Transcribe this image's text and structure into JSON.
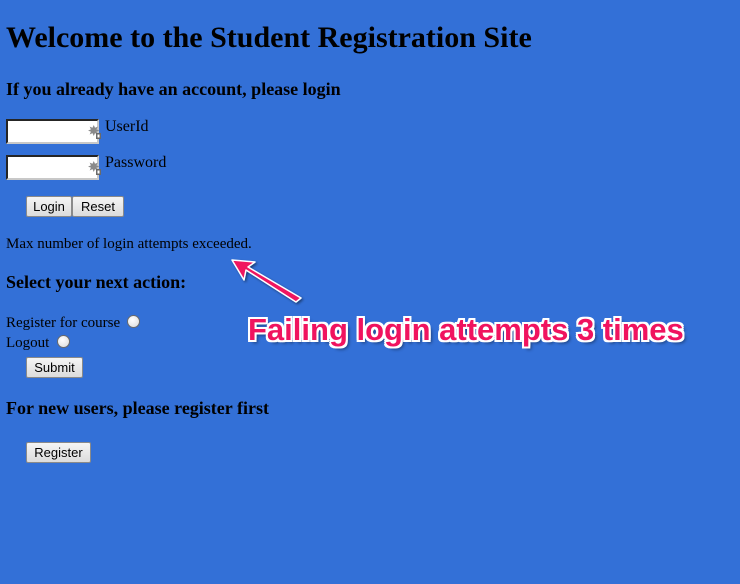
{
  "page": {
    "title": "Welcome to the Student Registration Site"
  },
  "login": {
    "heading": "If you already have an account, please login",
    "userid_label": "UserId",
    "userid_value": "",
    "password_label": "Password",
    "password_value": "",
    "login_button": "Login",
    "reset_button": "Reset",
    "status_message": "Max number of login attempts exceeded."
  },
  "actions": {
    "heading": "Select your next action:",
    "options": [
      {
        "label": "Register for course",
        "selected": false
      },
      {
        "label": "Logout",
        "selected": false
      }
    ],
    "submit_button": "Submit"
  },
  "new_user": {
    "heading": "For new users, please register first",
    "register_button": "Register"
  },
  "annotation": {
    "text": "Failing login attempts 3 times",
    "color": "#f0135f"
  },
  "colors": {
    "background": "#3370d7"
  },
  "icons": {
    "field_icon": "key-icon"
  }
}
